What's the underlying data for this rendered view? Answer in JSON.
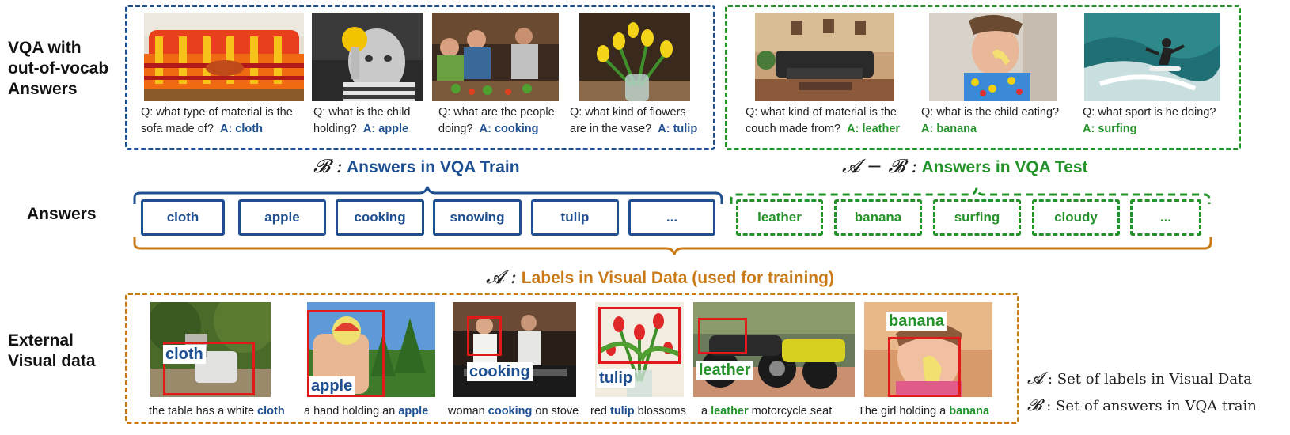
{
  "row_labels": {
    "vqa": [
      "VQA with",
      "out-of-vocab",
      "Answers"
    ],
    "answers": "Answers",
    "external": [
      "External",
      "Visual data"
    ]
  },
  "headings": {
    "b_symbol": "𝓑 :",
    "b_text": "Answers in VQA Train",
    "amb_symbol": "𝓐 − 𝓑 :",
    "amb_text": "Answers in VQA Test",
    "a_symbol": "𝓐 :",
    "a_text": "Labels in Visual Data (used for training)"
  },
  "train_examples": [
    {
      "q1": "Q: what type of material is the",
      "q2": "sofa made of?",
      "a": "A: cloth"
    },
    {
      "q1": "Q: what is the child",
      "q2": "holding?",
      "a": "A: apple"
    },
    {
      "q1": "Q: what are the people",
      "q2": "doing?",
      "a": "A: cooking"
    },
    {
      "q1": "Q: what kind of flowers",
      "q2": "are in the vase?",
      "a": "A: tulip"
    }
  ],
  "test_examples": [
    {
      "q1": "Q: what kind of material is the",
      "q2": "couch made from?",
      "a": "A: leather"
    },
    {
      "q1": "Q: what is the child eating?",
      "q2": "",
      "a": "A: banana"
    },
    {
      "q1": "Q: what sport is he doing?",
      "q2": "",
      "a": "A: surfing"
    }
  ],
  "train_answers": [
    "cloth",
    "apple",
    "cooking",
    "snowing",
    "tulip",
    "..."
  ],
  "test_answers": [
    "leather",
    "banana",
    "surfing",
    "cloudy",
    "..."
  ],
  "visual_examples": [
    {
      "tag": "cloth",
      "pre": "the table has a white ",
      "word": "cloth",
      "post": ""
    },
    {
      "tag": "apple",
      "pre": "a hand holding an ",
      "word": "apple",
      "post": ""
    },
    {
      "tag": "cooking",
      "pre": "woman ",
      "word": "cooking",
      "post": " on stove"
    },
    {
      "tag": "tulip",
      "pre": "red ",
      "word": "tulip",
      "post": " blossoms"
    },
    {
      "tag": "leather",
      "pre": "a ",
      "word": "leather",
      "post": " motorcycle seat"
    },
    {
      "tag": "banana",
      "pre": "The girl holding a ",
      "word": "banana",
      "post": ""
    }
  ],
  "legend": {
    "a_sym": "𝓐",
    "a_text": " : Set of labels in Visual Data",
    "b_sym": "𝓑",
    "b_text": " : Set of answers in VQA train"
  },
  "colors": {
    "train": "#1d4f91",
    "test": "#23932a",
    "visual": "#c97a17",
    "region": "#e01919"
  }
}
